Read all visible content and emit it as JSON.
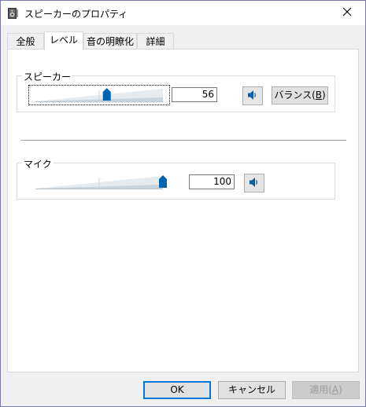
{
  "window": {
    "title": "スピーカーのプロパティ"
  },
  "tabs": [
    {
      "label": "全般"
    },
    {
      "label": "レベル"
    },
    {
      "label": "音の明瞭化"
    },
    {
      "label": "詳細"
    }
  ],
  "speaker": {
    "label": "スピーカー",
    "value": "56",
    "level_percent": 56,
    "balance_label_prefix": "バランス(",
    "balance_mnemonic": "B",
    "balance_label_suffix": ")"
  },
  "mic": {
    "label": "マイク",
    "value": "100",
    "level_percent": 100
  },
  "buttons": {
    "ok": "OK",
    "cancel": "キャンセル",
    "apply_prefix": "適用(",
    "apply_mnemonic": "A",
    "apply_suffix": ")"
  },
  "icons": {
    "title": "speaker-device-icon",
    "close": "close-icon",
    "mute": "speaker-volume-icon"
  },
  "colors": {
    "accent": "#0078d7",
    "thumb": "#0063b1"
  }
}
